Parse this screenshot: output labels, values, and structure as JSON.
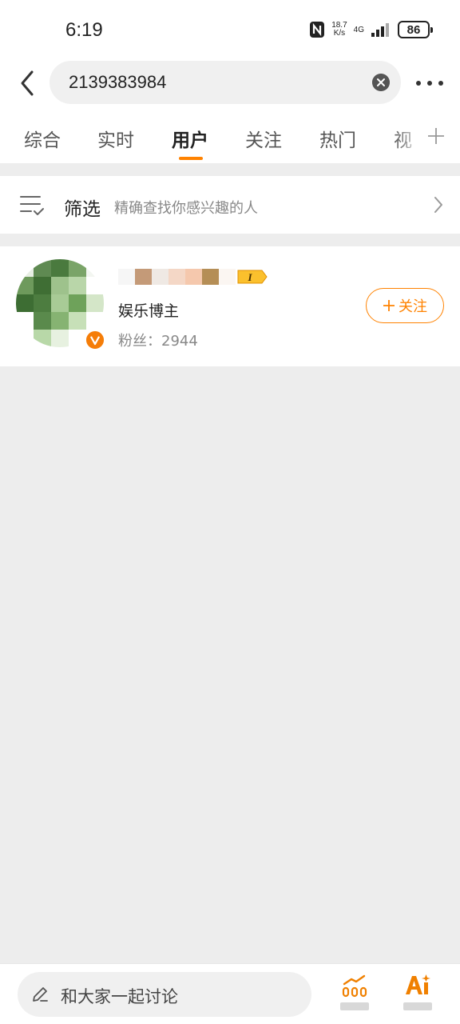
{
  "status_bar": {
    "time": "6:19",
    "net_speed_value": "18.7",
    "net_speed_unit": "K/s",
    "network": "4G",
    "battery": "86"
  },
  "search": {
    "query": "2139383984"
  },
  "tabs": [
    {
      "label": "综合",
      "active": false
    },
    {
      "label": "实时",
      "active": false
    },
    {
      "label": "用户",
      "active": true
    },
    {
      "label": "关注",
      "active": false
    },
    {
      "label": "热门",
      "active": false
    },
    {
      "label": "视",
      "active": false
    }
  ],
  "filter": {
    "label": "筛选",
    "description": "精确查找你感兴趣的人"
  },
  "user": {
    "level": "I",
    "role": "娱乐博主",
    "fans": "粉丝：2944",
    "follow_label": "关注"
  },
  "bottom_bar": {
    "comment_placeholder": "和大家一起讨论"
  },
  "colors": {
    "accent": "#ff8200",
    "verified": "#f57d08",
    "background": "#ededed"
  },
  "icons": [
    "back-icon",
    "clear-icon",
    "more-icon",
    "plus-icon",
    "filter-icon",
    "chevron-right-icon",
    "verified-icon",
    "pen-icon",
    "stats-icon",
    "ai-icon"
  ]
}
